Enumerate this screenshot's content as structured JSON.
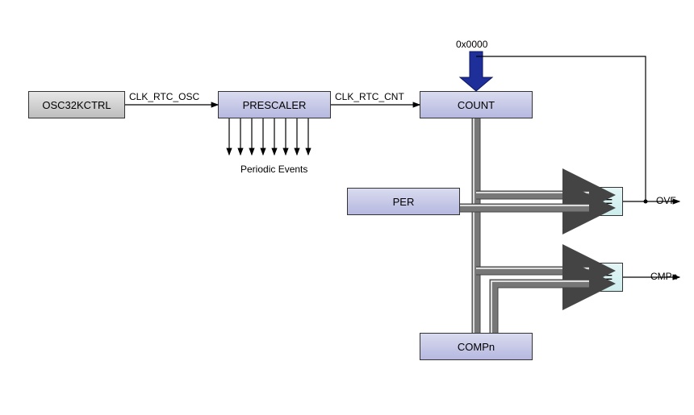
{
  "reset_value": "0x0000",
  "blocks": {
    "osc": "OSC32KCTRL",
    "prescaler": "PRESCALER",
    "count": "COUNT",
    "per": "PER",
    "compn": "COMPn",
    "eq1": "=",
    "eq2": "="
  },
  "signals": {
    "clk_rtc_osc": "CLK_RTC_OSC",
    "clk_rtc_cnt": "CLK_RTC_CNT",
    "periodic_events": "Periodic Events",
    "ovf": "OVF",
    "cmpn": "CMPn"
  }
}
